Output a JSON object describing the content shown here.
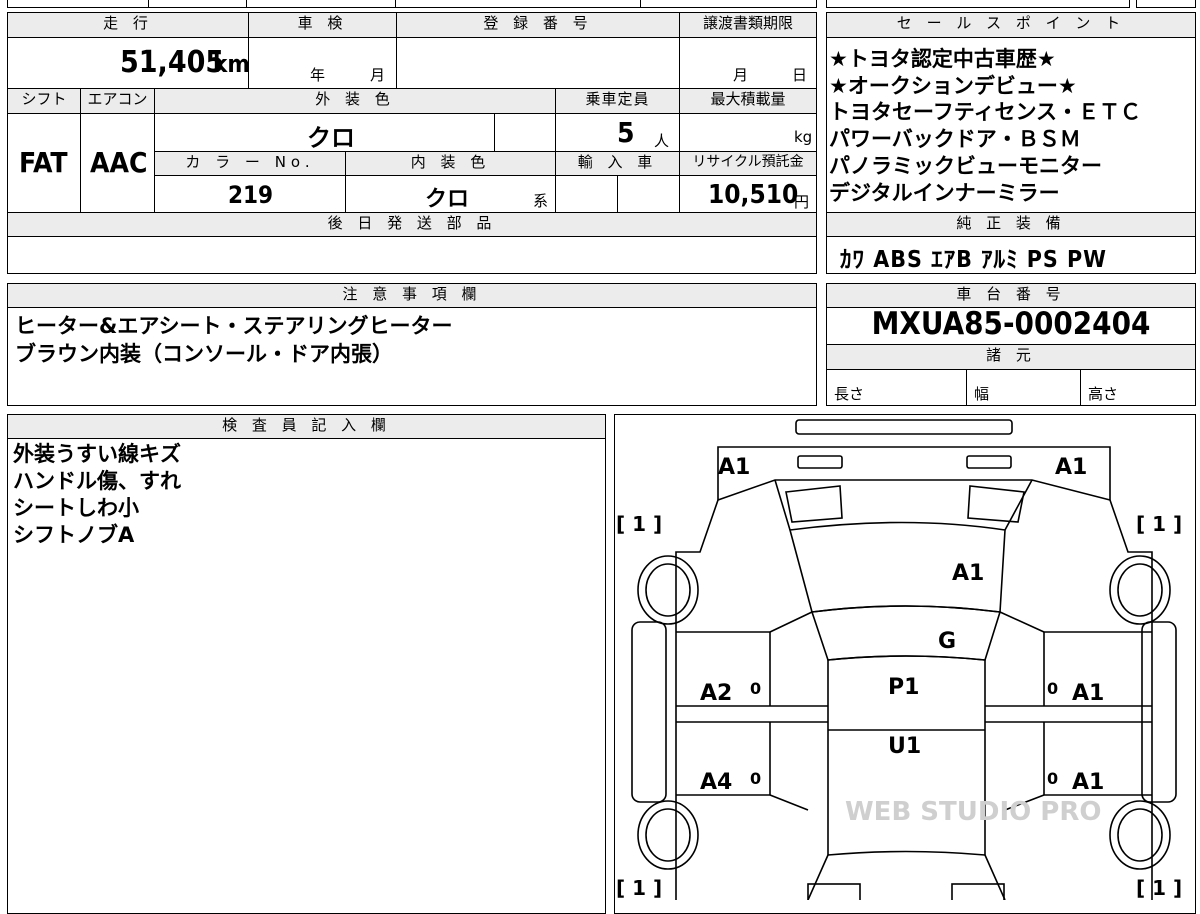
{
  "vehicle": {
    "headers": {
      "mileage": "走 行",
      "inspection": "車 検",
      "registration": "登 録 番 号",
      "transfer_deadline": "譲渡書類期限",
      "shift": "シフト",
      "aircon": "エアコン",
      "exterior_color": "外 装 色",
      "capacity": "乗車定員",
      "max_load": "最大積載量",
      "color_no": "カ ラ ー No.",
      "interior_color": "内 装 色",
      "import": "輸 入 車",
      "recycle_fee": "リサイクル預託金",
      "later_parts": "後 日 発 送 部 品"
    },
    "mileage": "51,405",
    "mileage_unit": "km",
    "year_unit": "年",
    "month_unit": "月",
    "deadline_month": "月",
    "deadline_day": "日",
    "shift": "FAT",
    "aircon": "AAC",
    "exterior_color": "クロ",
    "capacity": "5",
    "capacity_unit": "人",
    "max_load_unit": "kg",
    "color_no": "219",
    "interior_color": "クロ",
    "interior_suffix": "系",
    "recycle_fee": "10,510",
    "recycle_unit": "円"
  },
  "sales_points": {
    "header": "セ ー ル ス ポ イ ン ト",
    "lines": [
      "★トヨタ認定中古車歴★",
      "★オークションデビュー★",
      "トヨタセーフティセンス・ＥＴＣ",
      "パワーバックドア・ＢＳＭ",
      "パノラミックビューモニター",
      "デジタルインナーミラー"
    ]
  },
  "equipment": {
    "header": "純 正 装 備",
    "items": "ｶﾜ ABS ｴｱB ｱﾙﾐ PS PW"
  },
  "notes": {
    "header": "注 意 事 項 欄",
    "lines": [
      "ヒーター&エアシート・ステアリングヒーター",
      "ブラウン内装（コンソール・ドア内張）"
    ]
  },
  "chassis": {
    "header": "車 台 番 号",
    "number": "MXUA85-0002404"
  },
  "specs": {
    "header": "諸 元",
    "length": "長さ",
    "width": "幅",
    "height": "高さ"
  },
  "inspector": {
    "header": "検 査 員 記 入 欄",
    "lines": [
      "外装うすい線キズ",
      "ハンドル傷、すれ",
      "シートしわ小",
      "シフトノブA"
    ]
  },
  "diagram": {
    "front_left": "A1",
    "front_right": "A1",
    "hood": "A1",
    "windshield": "G",
    "roof": "P1",
    "rear_roof": "U1",
    "left_front_door": "A2",
    "left_rear_door": "A4",
    "right_front_door": "A1",
    "right_rear_door": "A1",
    "door_small": "0",
    "wheel_mark": "[ 1 ]",
    "watermark": "WEB STUDIO PRO"
  }
}
